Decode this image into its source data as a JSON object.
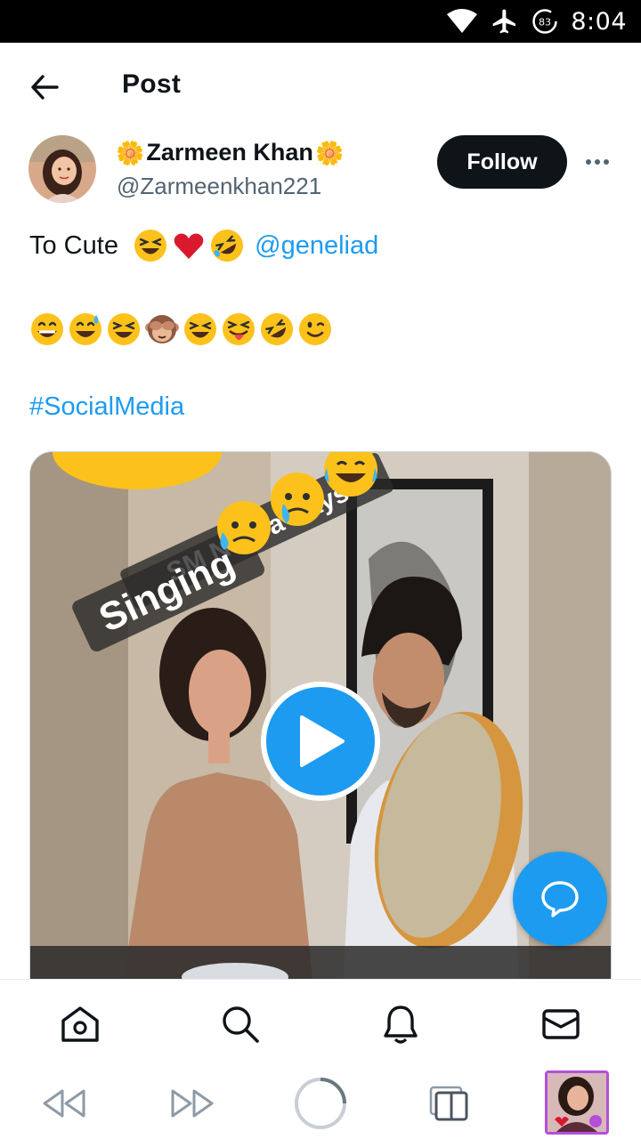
{
  "status_bar": {
    "time": "8:04",
    "battery": "83",
    "icons": [
      "wifi-icon",
      "airplane-mode-icon",
      "battery-saver-icon"
    ]
  },
  "header": {
    "title": "Post",
    "back_icon": "arrow-left-icon"
  },
  "author": {
    "display_name": "Zarmeen Khan",
    "name_decoration": "🌼",
    "handle": "@Zarmeenkhan221",
    "follow_label": "Follow",
    "more_icon": "more-horizontal-icon"
  },
  "post": {
    "line1_text": "To Cute",
    "line1_emojis": [
      "laughing-emoji",
      "red-heart-emoji",
      "rofl-emoji"
    ],
    "mention": "@geneliad",
    "line2_emojis": [
      "grinning-emoji",
      "sweat-smile-emoji",
      "laughing-emoji",
      "see-no-evil-monkey-emoji",
      "laughing-emoji",
      "squinting-tongue-emoji",
      "rofl-emoji",
      "winking-emoji"
    ],
    "hashtag": "#SocialMedia"
  },
  "media": {
    "type": "video",
    "overlay_caption": "SM Now a Days",
    "overlay_label": "Singing",
    "play_icon": "play-icon"
  },
  "compose_fab_icon": "reply-bubble-icon",
  "tab_bar": [
    {
      "name": "home",
      "icon": "home-icon"
    },
    {
      "name": "search",
      "icon": "search-icon"
    },
    {
      "name": "notifications",
      "icon": "bell-icon"
    },
    {
      "name": "messages",
      "icon": "mail-icon"
    }
  ],
  "nav_bar": [
    {
      "name": "rewind",
      "icon": "rewind-icon"
    },
    {
      "name": "fast-forward",
      "icon": "fast-forward-icon"
    },
    {
      "name": "home",
      "icon": "circle-home-icon"
    },
    {
      "name": "recents",
      "icon": "recents-icon"
    },
    {
      "name": "thumbnail",
      "icon": "app-thumbnail"
    }
  ],
  "colors": {
    "accent": "#1d9bf0",
    "text_primary": "#0f1419",
    "text_secondary": "#536471",
    "follow_bg": "#0f1419"
  }
}
